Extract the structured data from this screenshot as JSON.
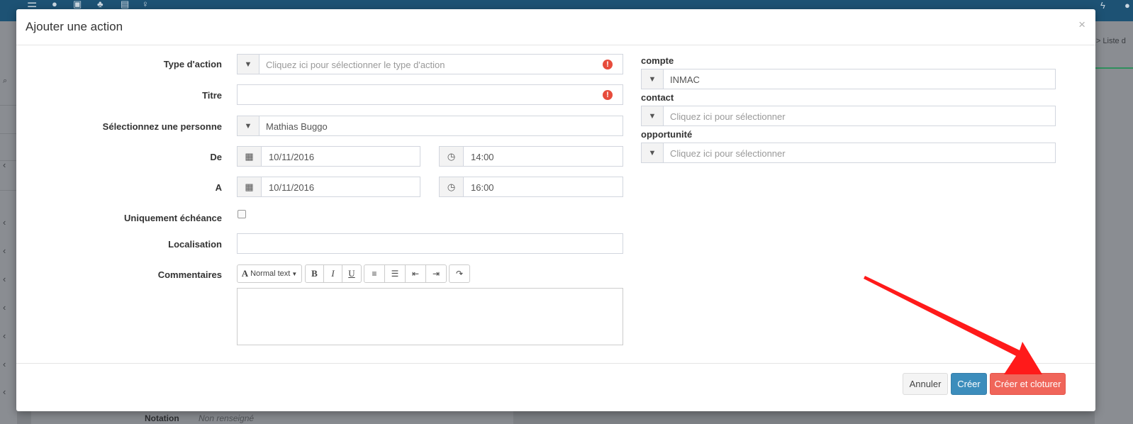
{
  "modal": {
    "title": "Ajouter une action",
    "close_glyph": "×"
  },
  "form": {
    "type_action": {
      "label": "Type d'action",
      "placeholder": "Cliquez ici pour sélectionner le type d'action"
    },
    "titre": {
      "label": "Titre",
      "value": ""
    },
    "personne": {
      "label": "Sélectionnez une personne",
      "value": "Mathias Buggo"
    },
    "de": {
      "label": "De",
      "date": "10/11/2016",
      "time": "14:00"
    },
    "a": {
      "label": "A",
      "date": "10/11/2016",
      "time": "16:00"
    },
    "echeance": {
      "label": "Uniquement échéance",
      "checked": false
    },
    "localisation": {
      "label": "Localisation",
      "value": ""
    },
    "commentaires": {
      "label": "Commentaires",
      "toolbar": {
        "style_label": "Normal text",
        "bold": "B",
        "italic": "I",
        "underline": "U"
      },
      "value": ""
    }
  },
  "side": {
    "compte": {
      "label": "compte",
      "value": "INMAC"
    },
    "contact": {
      "label": "contact",
      "placeholder": "Cliquez ici pour sélectionner"
    },
    "opportunite": {
      "label": "opportunité",
      "placeholder": "Cliquez ici pour sélectionner"
    }
  },
  "footer": {
    "cancel_label": "Annuler",
    "create_label": "Créer",
    "create_close_label": "Créer et cloturer"
  },
  "background": {
    "breadcrumb": "ll  >  Liste d",
    "bottom_label": "Notation",
    "bottom_value": "Non renseigné"
  },
  "colors": {
    "topbar": "#1d5274",
    "primary": "#3c8dbc",
    "danger_button": "#f0655a",
    "error_icon": "#e74c3c",
    "arrow": "#ff1a1a"
  }
}
